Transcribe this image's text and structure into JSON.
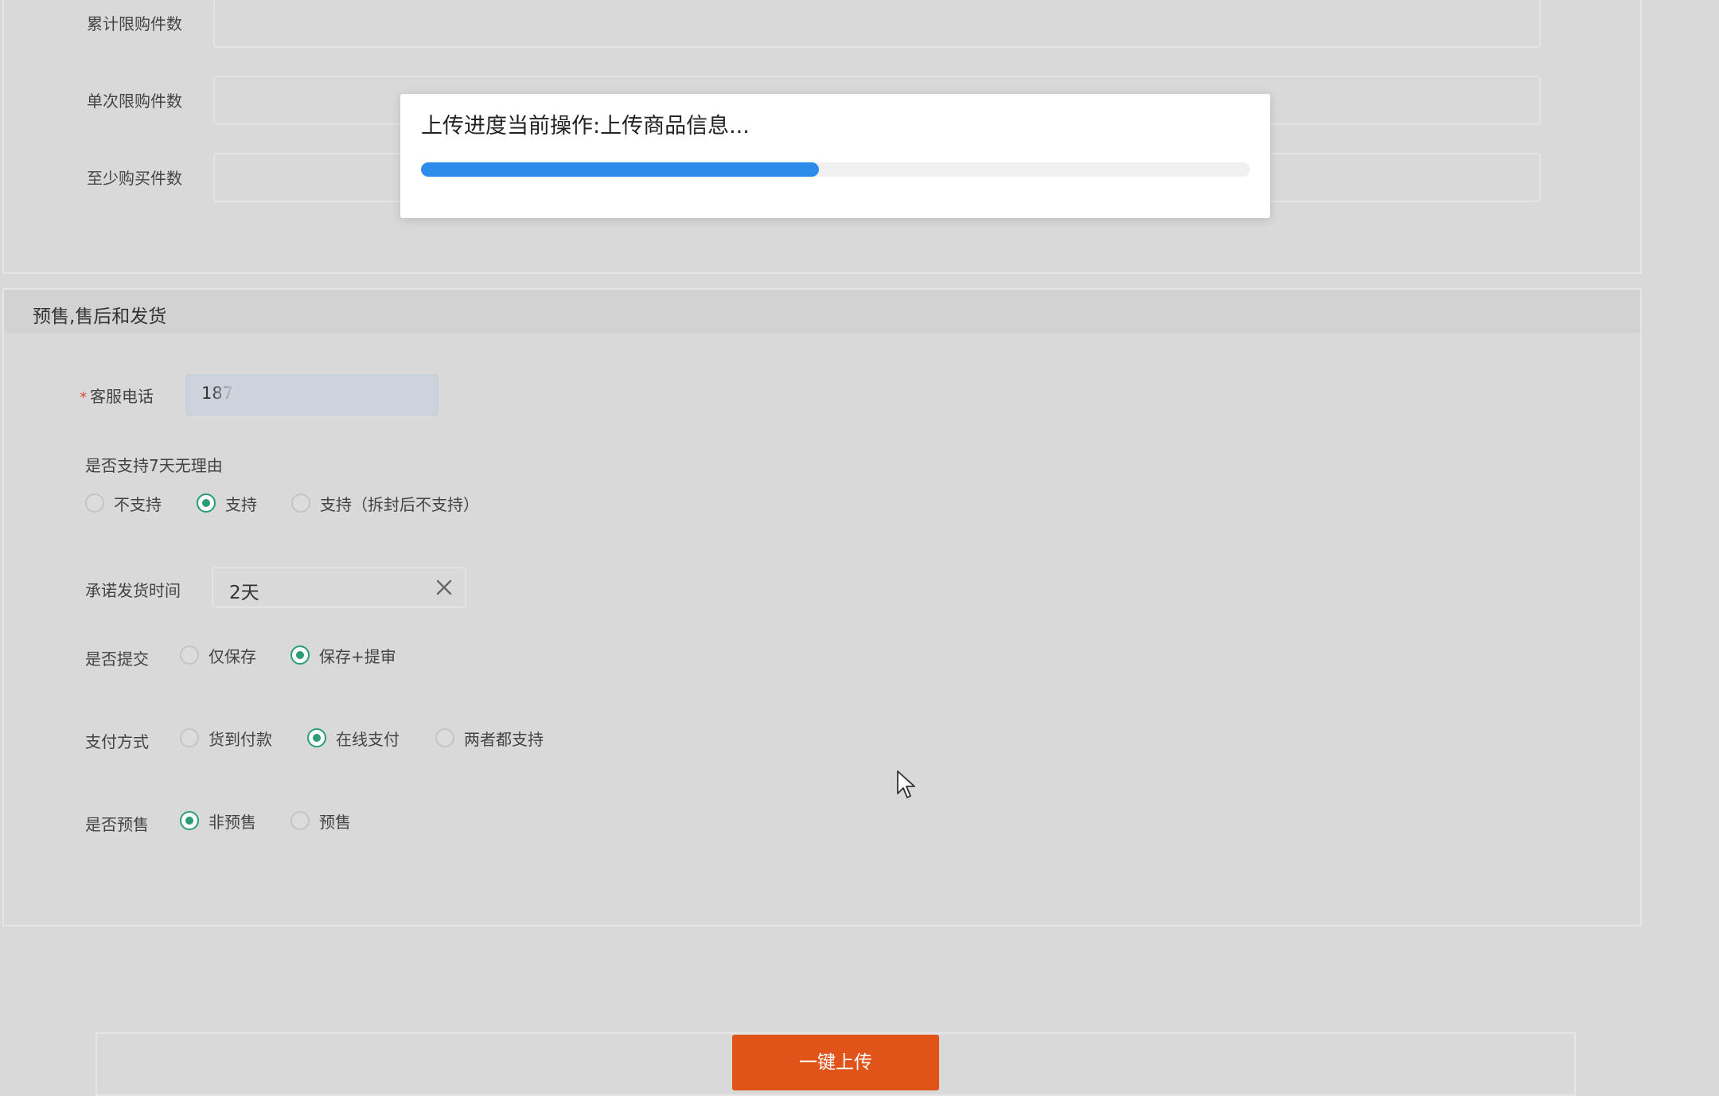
{
  "limits": {
    "cumulative_label": "累计限购件数",
    "single_label": "单次限购件数",
    "minimum_label": "至少购买件数"
  },
  "section": {
    "title": "预售,售后和发货"
  },
  "service_phone": {
    "label": "客服电话",
    "required_mark": "*",
    "value": "187"
  },
  "seven_day": {
    "label": "是否支持7天无理由",
    "options": [
      "不支持",
      "支持",
      "支持（拆封后不支持）"
    ],
    "selected": "支持"
  },
  "ship_time": {
    "label": "承诺发货时间",
    "value": "2天"
  },
  "submit_mode": {
    "label": "是否提交",
    "options": [
      "仅保存",
      "保存+提审"
    ],
    "selected": "保存+提审"
  },
  "payment": {
    "label": "支付方式",
    "options": [
      "货到付款",
      "在线支付",
      "两者都支持"
    ],
    "selected": "在线支付"
  },
  "presale": {
    "label": "是否预售",
    "options": [
      "非预售",
      "预售"
    ],
    "selected": "非预售"
  },
  "upload_button": "一键上传",
  "modal": {
    "title": "上传进度当前操作:上传商品信息...",
    "progress_fraction": 0.48
  },
  "colors": {
    "accent": "#2a9d74",
    "progress": "#2d8ceb",
    "primary_button": "#e0541a"
  }
}
